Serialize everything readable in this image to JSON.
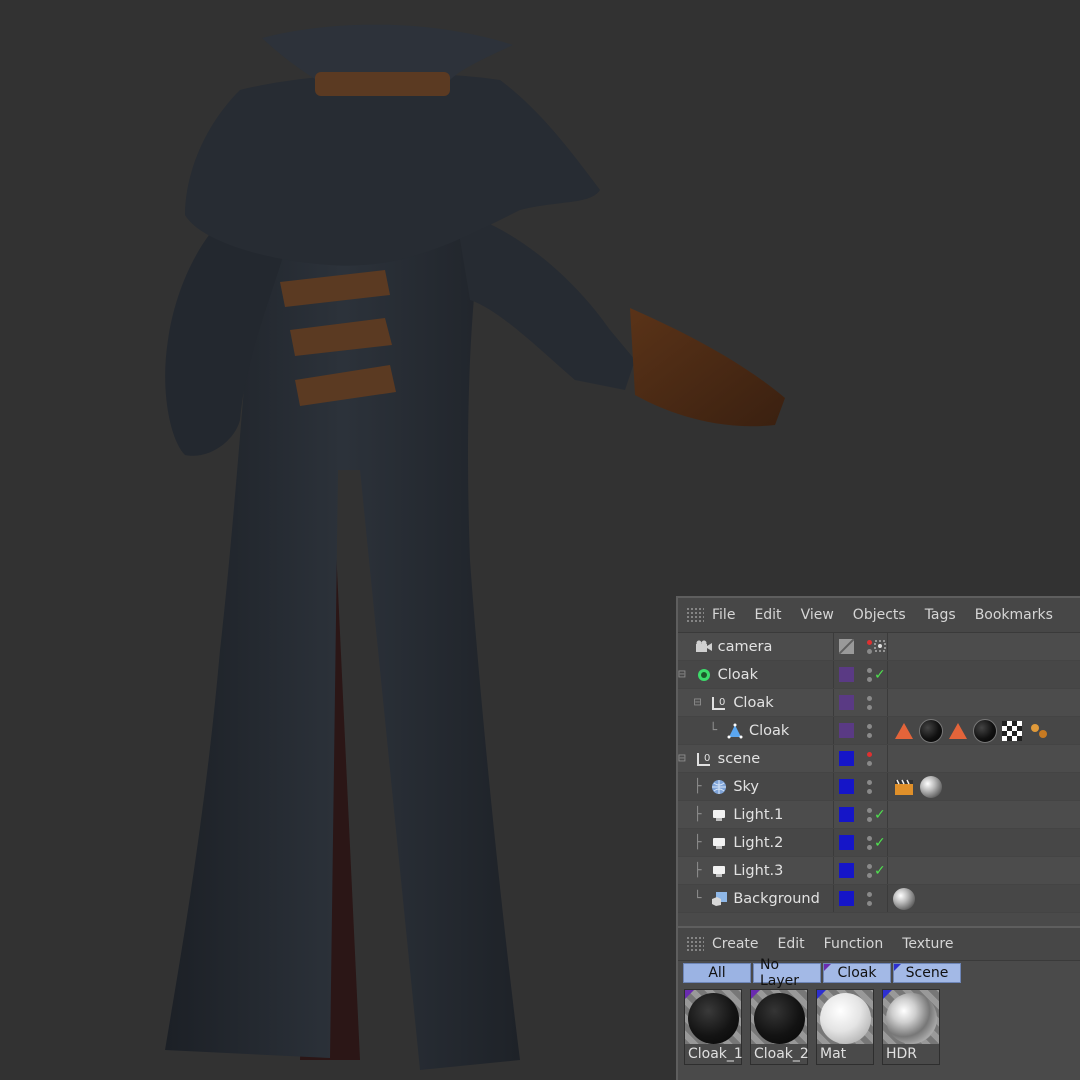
{
  "object_manager": {
    "menu": [
      "File",
      "Edit",
      "View",
      "Objects",
      "Tags",
      "Bookmarks"
    ],
    "objects": [
      {
        "name": "camera",
        "tree": " ",
        "icon": "camera-icon",
        "layer_color": "#4a4a4a",
        "has_layer_slash": true,
        "checked": false
      },
      {
        "name": "Cloak",
        "tree": "⊟",
        "icon": "cloth-icon",
        "layer_color": "#5a3a84",
        "checked": true
      },
      {
        "name": "Cloak",
        "tree": "  ⊟",
        "icon": "null-icon",
        "layer_color": "#5a3a84",
        "checked": false
      },
      {
        "name": "Cloak",
        "tree": "    └",
        "icon": "polygon-icon",
        "layer_color": "#5a3a84",
        "checked": false
      },
      {
        "name": "scene",
        "tree": "⊟",
        "icon": "null-icon",
        "layer_color": "#1515c8",
        "checked": false
      },
      {
        "name": "Sky",
        "tree": "  ├",
        "icon": "sky-icon",
        "layer_color": "#1515c8",
        "checked": false
      },
      {
        "name": "Light.1",
        "tree": "  ├",
        "icon": "light-icon",
        "layer_color": "#1515c8",
        "checked": true
      },
      {
        "name": "Light.2",
        "tree": "  ├",
        "icon": "light-icon",
        "layer_color": "#1515c8",
        "checked": true
      },
      {
        "name": "Light.3",
        "tree": "  ├",
        "icon": "light-icon",
        "layer_color": "#1515c8",
        "checked": true
      },
      {
        "name": "Background",
        "tree": "  └",
        "icon": "background-icon",
        "layer_color": "#1515c8",
        "checked": false
      }
    ]
  },
  "material_manager": {
    "menu": [
      "Create",
      "Edit",
      "Function",
      "Texture"
    ],
    "filters": [
      "All",
      "No Layer",
      "Cloak",
      "Scene"
    ],
    "materials": [
      {
        "name": "Cloak_1",
        "type": "dark"
      },
      {
        "name": "Cloak_2",
        "type": "dark"
      },
      {
        "name": "Mat",
        "type": "white"
      },
      {
        "name": "HDR",
        "type": "chrome"
      }
    ]
  }
}
